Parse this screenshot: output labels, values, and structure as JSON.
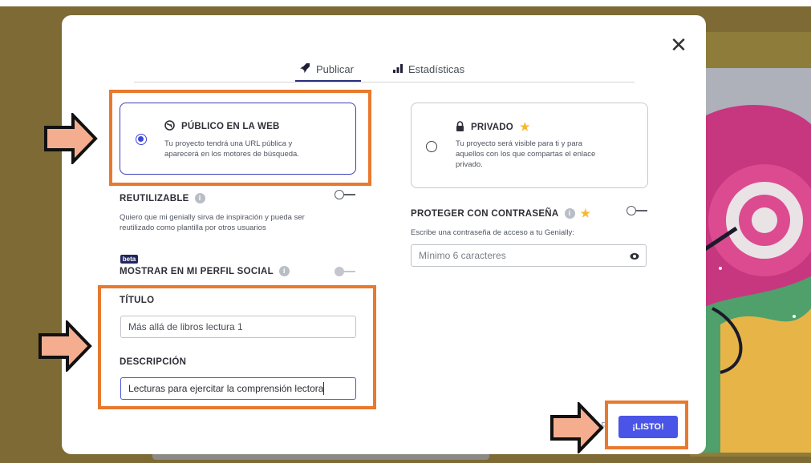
{
  "tabs": [
    {
      "label": "Publicar",
      "icon": "rocket-icon",
      "active": true
    },
    {
      "label": "Estadísticas",
      "icon": "bar-chart-icon",
      "active": false
    }
  ],
  "public": {
    "title": "PÚBLICO EN LA WEB",
    "icon": "globe-icon",
    "selected": true,
    "desc": [
      "Tu proyecto tendrá una URL pública y",
      "aparecerá en los motores de búsqueda."
    ]
  },
  "private": {
    "title": "PRIVADO",
    "icon": "lock-icon",
    "premium_icon": "star-icon",
    "selected": false,
    "desc": [
      "Tu proyecto será visible para ti y para",
      "aquellos con los que compartas el enlace",
      "privado."
    ]
  },
  "reusable": {
    "label": "REUTILIZABLE",
    "desc": [
      "Quiero que mi genially sirva de inspiración y pueda ser",
      "reutilizado como plantilla por otros usuarios"
    ],
    "enabled": false
  },
  "social": {
    "badge": "beta",
    "label": "MOSTRAR EN MI PERFIL SOCIAL",
    "enabled": false,
    "disabled": true
  },
  "password": {
    "label": "PROTEGER CON CONTRASEÑA",
    "desc": "Escribe una contraseña de acceso a tu Genially:",
    "placeholder": "Mínimo 6 caracteres",
    "enabled": false
  },
  "title_field": {
    "label": "TÍTULO",
    "value": "Más allá de libros lectura 1"
  },
  "description_field": {
    "label": "DESCRIPCIÓN",
    "value": "Lecturas para ejercitar la comprensión lectora"
  },
  "done_button": "¡LISTO!",
  "colors": {
    "accent": "#4a54e6",
    "highlight": "#e8792d",
    "arrow_fill": "#f4ae8f",
    "star": "#f5b82e"
  }
}
